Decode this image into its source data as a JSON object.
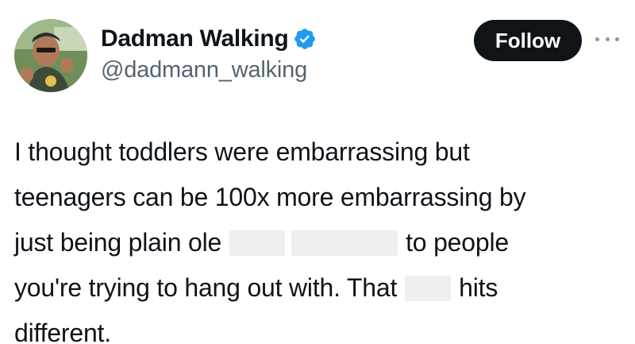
{
  "author": {
    "display_name": "Dadman Walking",
    "handle": "@dadmann_walking",
    "verified_icon": "verified-badge-icon",
    "verified_color": "#1d9bf0",
    "avatar_icon": "profile-photo"
  },
  "actions": {
    "follow_label": "Follow",
    "more_icon": "more-options-icon"
  },
  "tweet": {
    "line1": "I thought toddlers were embarrassing but",
    "line2": "teenagers can be 100x more embarrassing by",
    "line3_a": "just being plain ole",
    "line3_b": "to people",
    "line4_a": "you're trying to hang out with. That",
    "line4_b": "hits",
    "line5": "different.",
    "redactions": 3
  },
  "colors": {
    "text": "#0f1419",
    "secondary": "#536471",
    "button_bg": "#0f1419",
    "button_text": "#ffffff",
    "redaction": "#efefef"
  }
}
